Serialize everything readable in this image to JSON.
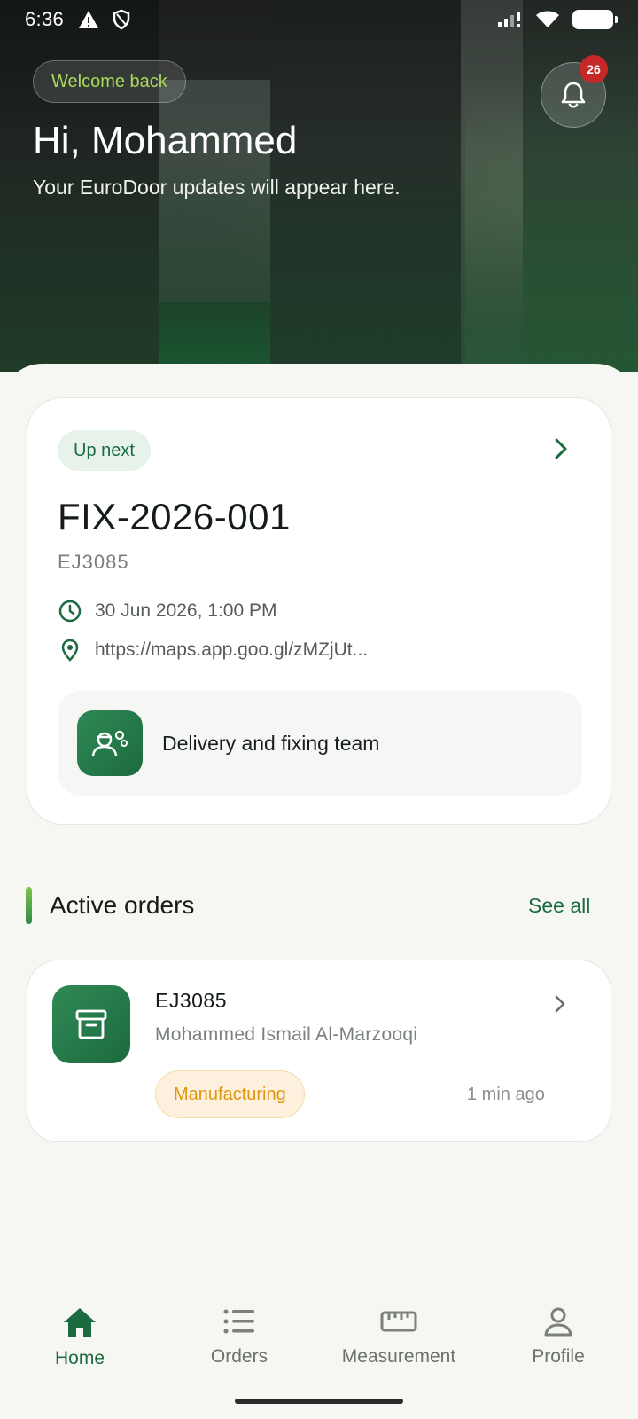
{
  "status_bar": {
    "time": "6:36"
  },
  "header": {
    "welcome": "Welcome back",
    "greeting": "Hi, Mohammed",
    "subtitle": "Your EuroDoor updates will appear here.",
    "notification_count": "26"
  },
  "up_next": {
    "pill": "Up next",
    "job_code": "FIX-2026-001",
    "order_ref": "EJ3085",
    "datetime": "30 Jun 2026, 1:00 PM",
    "location": "https://maps.app.goo.gl/zMZjUt...",
    "team": "Delivery and fixing team"
  },
  "active_orders": {
    "title": "Active orders",
    "see_all": "See all",
    "items": [
      {
        "order_id": "EJ3085",
        "customer": "Mohammed Ismail Al-Marzooqi",
        "status": "Manufacturing",
        "updated": "1 min ago"
      }
    ]
  },
  "bottom_nav": {
    "items": [
      {
        "label": "Home",
        "icon": "home-icon",
        "active": true
      },
      {
        "label": "Orders",
        "icon": "list-icon",
        "active": false
      },
      {
        "label": "Measurement",
        "icon": "ruler-icon",
        "active": false
      },
      {
        "label": "Profile",
        "icon": "person-icon",
        "active": false
      }
    ]
  },
  "colors": {
    "brand_green": "#1c6b40",
    "accent_lime": "#a9d95a",
    "status_orange": "#e0960e",
    "badge_red": "#c62828"
  }
}
